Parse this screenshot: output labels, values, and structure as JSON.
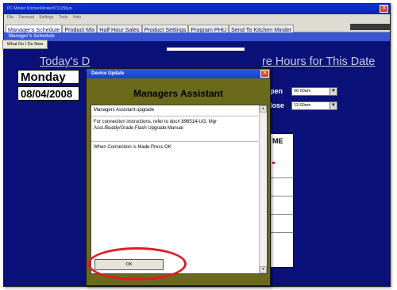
{
  "app": {
    "title": "PC Minder  KitchenMinder8711256un",
    "menu": [
      "File",
      "Forecast",
      "Settings",
      "Tools",
      "Help"
    ],
    "close_glyph": "✕"
  },
  "tabs": [
    {
      "label": "Manager's Schedule",
      "active": true
    },
    {
      "label": "Product Mix",
      "active": false
    },
    {
      "label": "Half Hour Sales",
      "active": false
    },
    {
      "label": "Product Settings",
      "active": false
    },
    {
      "label": "Program PHU",
      "active": false
    },
    {
      "label": "Send To Kitchen Minder",
      "active": false
    }
  ],
  "subheader": "Manager's Schedule",
  "what_button": "What Do I Do Now",
  "main": {
    "todays_label": "Today's D",
    "store_hours_label": "re Hours for This Date",
    "day": "Monday",
    "date": "08/04/2008",
    "open_label": "pen",
    "open_value": "06:00am",
    "close_label": "lose",
    "close_value": "12:00am",
    "table_header": "ME"
  },
  "dialog": {
    "title": "Device Update",
    "heading": "Managers Assistant",
    "lines": [
      "Managers Assistant upgrade",
      "For connection instructions, refer to doc# 896514-UG, Mgr Asst./Buddy/Grade Flash Upgrade Manual",
      "When Connection is Made Press OK"
    ],
    "ok_label": "OK",
    "close_glyph": "✕"
  },
  "colors": {
    "app_background": "#0a1178",
    "dialog_background": "#6b6a1a",
    "highlight": "#e11b22"
  }
}
